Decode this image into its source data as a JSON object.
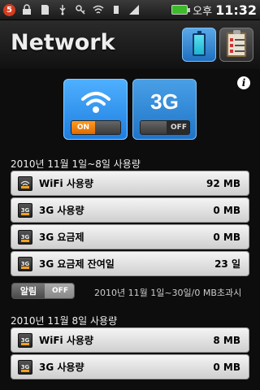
{
  "status_bar": {
    "notification_count": "5",
    "ampm": "오후",
    "time": "11:32"
  },
  "header": {
    "title": "Network"
  },
  "toggles": {
    "wifi": {
      "state_label": "ON"
    },
    "g3": {
      "label": "3G",
      "state_label": "OFF"
    }
  },
  "period_usage": {
    "title": "2010년 11월 1일~8일 사용량",
    "rows": [
      {
        "label": "WiFi 사용량",
        "value": "92 MB",
        "icon": "wifi-icon"
      },
      {
        "label": "3G 사용량",
        "value": "0 MB",
        "icon": "3g-icon"
      },
      {
        "label": "3G 요금제",
        "value": "0 MB",
        "icon": "3g-icon"
      },
      {
        "label": "3G 요금제 잔여일",
        "value": "23 일",
        "icon": "calendar-icon"
      }
    ]
  },
  "alarm": {
    "label": "알림",
    "state": "OFF",
    "text": "2010년 11월 1일~30일/0 MB초과시"
  },
  "daily_usage": {
    "title": "2010년 11월 8일 사용량",
    "rows": [
      {
        "label": "WiFi 사용량",
        "value": "8 MB",
        "icon": "3g-icon"
      },
      {
        "label": "3G 사용량",
        "value": "0 MB",
        "icon": "3g-icon"
      }
    ]
  },
  "colors": {
    "accent_blue": "#1e7ee0",
    "on_orange": "#e06a00"
  }
}
